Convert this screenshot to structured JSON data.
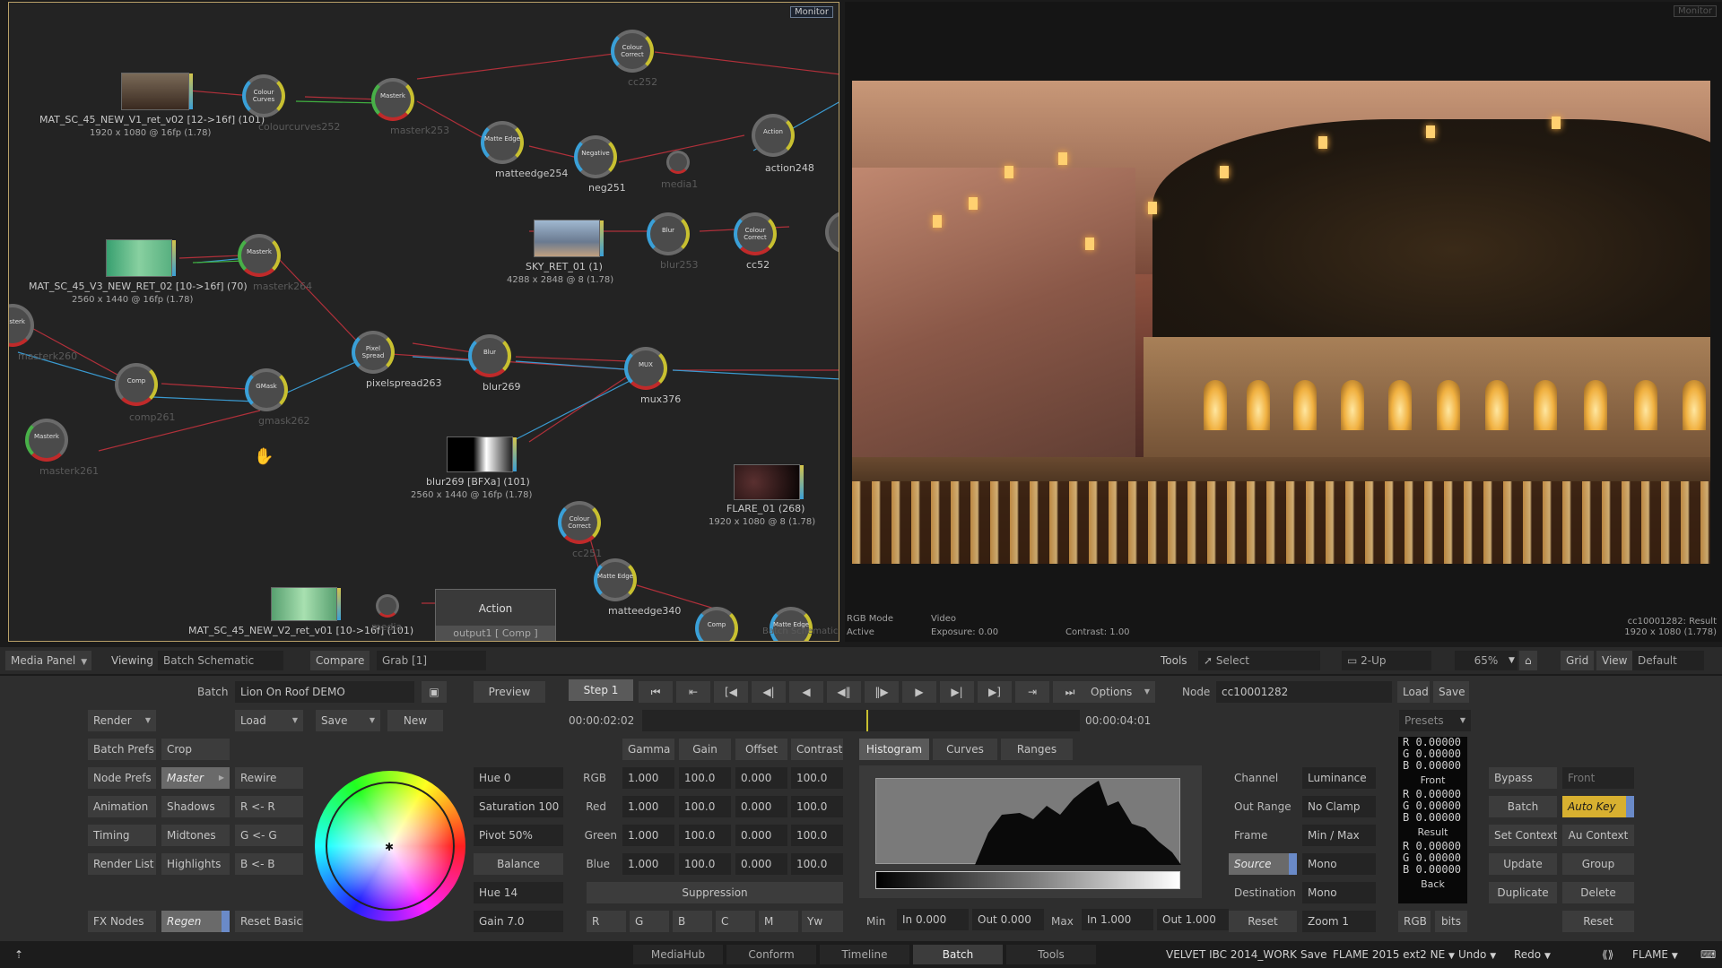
{
  "schematic": {
    "monitor_tag": "Monitor",
    "nodes": {
      "cc252": {
        "cap": "Colour Correct",
        "label": "cc252"
      },
      "curves": {
        "cap": "Colour Curves",
        "label": "colourcurves252"
      },
      "mk253": {
        "cap": "Masterk",
        "label": "masterk253"
      },
      "me254": {
        "cap": "Matte Edge",
        "label": "matteedge254"
      },
      "neg251": {
        "cap": "Negative",
        "label": "neg251"
      },
      "media1": {
        "cap": "",
        "label": "media1"
      },
      "action248": {
        "cap": "Action",
        "label": "action248"
      },
      "mk264": {
        "cap": "Masterk",
        "label": "masterk264"
      },
      "blur253": {
        "cap": "Blur",
        "label": "blur253"
      },
      "cc52": {
        "cap": "Colour Correct",
        "label": "cc52"
      },
      "mk260": {
        "cap": "Masterk",
        "label": "masterk260"
      },
      "comp261": {
        "cap": "Comp",
        "label": "comp261"
      },
      "gmask262": {
        "cap": "GMask",
        "label": "gmask262"
      },
      "ps263": {
        "cap": "Pixel Spread",
        "label": "pixelspread263"
      },
      "blur269": {
        "cap": "Blur",
        "label": "blur269"
      },
      "mux376": {
        "cap": "MUX",
        "label": "mux376"
      },
      "mk261": {
        "cap": "Masterk",
        "label": "masterk261"
      },
      "cc251": {
        "cap": "Colour Correct",
        "label": "cc251"
      },
      "me340": {
        "cap": "Matte Edge",
        "label": "matteedge340"
      },
      "comp": {
        "cap": "Comp",
        "label": ""
      },
      "me": {
        "cap": "Matte Edge",
        "label": "Batch Schematic"
      },
      "media": {
        "cap": "",
        "label": "media"
      }
    },
    "clips": {
      "clip1": {
        "label": "MAT_SC_45_NEW_V1_ret_v02 [12->16f] (101)",
        "sub": "1920 x 1080 @ 16fp (1.78)"
      },
      "clip2": {
        "label": "MAT_SC_45_V3_NEW_RET_02 [10->16f] (70)",
        "sub": "2560 x 1440 @ 16fp (1.78)"
      },
      "sky": {
        "label": "SKY_RET_01 (1)",
        "sub": "4288 x 2848 @ 8 (1.78)"
      },
      "blur269bfx": {
        "label": "blur269 [BFXa] (101)",
        "sub": "2560 x 1440 @ 16fp (1.78)"
      },
      "flare": {
        "label": "FLARE_01 (268)",
        "sub": "1920 x 1080 @ 8 (1.78)"
      },
      "clip3": {
        "label": "MAT_SC_45_NEW_V2_ret_v01 [10->16f] (101)",
        "sub": ""
      }
    },
    "action_box": {
      "title": "Action",
      "output": "output1 [ Comp ]"
    }
  },
  "player": {
    "monitor_tag": "Monitor",
    "rgb_mode": "RGB Mode",
    "active": "Active",
    "video": "Video",
    "exposure": "Exposure: 0.00",
    "contrast": "Contrast: 1.00",
    "result_name": "cc10001282: Result",
    "result_res": "1920 x 1080 (1.778)"
  },
  "toolbar": {
    "media_panel": "Media Panel",
    "viewing": "Viewing",
    "viewing_value": "Batch Schematic",
    "compare": "Compare",
    "grab": "Grab [1]",
    "tools": "Tools",
    "select": "Select",
    "two_up": "2-Up",
    "zoom": "65%",
    "grid": "Grid",
    "view": "View",
    "default": "Default"
  },
  "panel": {
    "batch_label": "Batch",
    "batch_name": "Lion On Roof DEMO",
    "preview": "Preview",
    "step": "Step 1",
    "options": "Options",
    "node_label": "Node",
    "node_name": "cc10001282",
    "load": "Load",
    "save": "Save",
    "render": "Render",
    "new": "New",
    "timecode_in": "00:00:02:02",
    "timecode_out": "00:00:04:01",
    "presets": "Presets",
    "left_col": [
      "Batch Prefs",
      "Node Prefs",
      "Animation",
      "Timing",
      "Render List",
      "FX Nodes"
    ],
    "crop": "Crop",
    "ranges_col": [
      "Master",
      "Shadows",
      "Midtones",
      "Highlights"
    ],
    "regen": "Regen",
    "rewire_col": [
      "Rewire",
      "R <- R",
      "G <- G",
      "B <- B"
    ],
    "reset_basics": "Reset Basics",
    "hue_top": "Hue  0",
    "saturation": "Saturation 100",
    "pivot": "Pivot 50%",
    "balance": "Balance",
    "hue_bottom": "Hue  14",
    "gain_field": "Gain 7.0",
    "grade_cols": [
      "Gamma",
      "Gain",
      "Offset",
      "Contrast"
    ],
    "grade_rows": [
      {
        "name": "RGB",
        "values": [
          "1.000",
          "100.0",
          "0.000",
          "100.0"
        ]
      },
      {
        "name": "Red",
        "values": [
          "1.000",
          "100.0",
          "0.000",
          "100.0"
        ]
      },
      {
        "name": "Green",
        "values": [
          "1.000",
          "100.0",
          "0.000",
          "100.0"
        ]
      },
      {
        "name": "Blue",
        "values": [
          "1.000",
          "100.0",
          "0.000",
          "100.0"
        ]
      }
    ],
    "suppression": "Suppression",
    "supp_btns": [
      "R",
      "G",
      "B",
      "C",
      "M",
      "Yw"
    ],
    "histo_tabs": [
      "Histogram",
      "Curves",
      "Ranges"
    ],
    "channel_label": "Channel",
    "channel_value": "Luminance",
    "out_range_label": "Out Range",
    "out_range_value": "No Clamp",
    "frame_label": "Frame",
    "frame_value": "Min / Max",
    "source": "Source",
    "source_mono": "Mono",
    "destination": "Destination",
    "dest_mono": "Mono",
    "reset": "Reset",
    "zoom": "Zoom 1",
    "min_label": "Min",
    "min_in": "In 0.000",
    "min_out": "Out 0.000",
    "max_label": "Max",
    "max_in": "In 1.000",
    "max_out": "Out 1.000",
    "readout": {
      "top": [
        "R  0.00000",
        "G  0.00000",
        "B  0.00000"
      ],
      "front_label": "Front",
      "front": [
        "R  0.00000",
        "G  0.00000",
        "B  0.00000"
      ],
      "result_label": "Result",
      "result": [
        "R  0.00000",
        "G  0.00000",
        "B  0.00000"
      ],
      "back_label": "Back"
    },
    "rgb": "RGB",
    "bits": "bits",
    "bypass": "Bypass",
    "front": "Front",
    "batch_btn": "Batch",
    "auto_key": "Auto Key",
    "set_context": "Set Context",
    "au_context": "Au Context",
    "update": "Update",
    "group": "Group",
    "duplicate": "Duplicate",
    "delete": "Delete",
    "reset_right": "Reset"
  },
  "bottombar": {
    "tabs": [
      "MediaHub",
      "Conform",
      "Timeline",
      "Batch",
      "Tools"
    ],
    "project": "VELVET IBC 2014_WORK",
    "save": "Save",
    "version": "FLAME 2015 ext2 NE",
    "undo": "Undo",
    "redo": "Redo",
    "product": "FLAME"
  }
}
